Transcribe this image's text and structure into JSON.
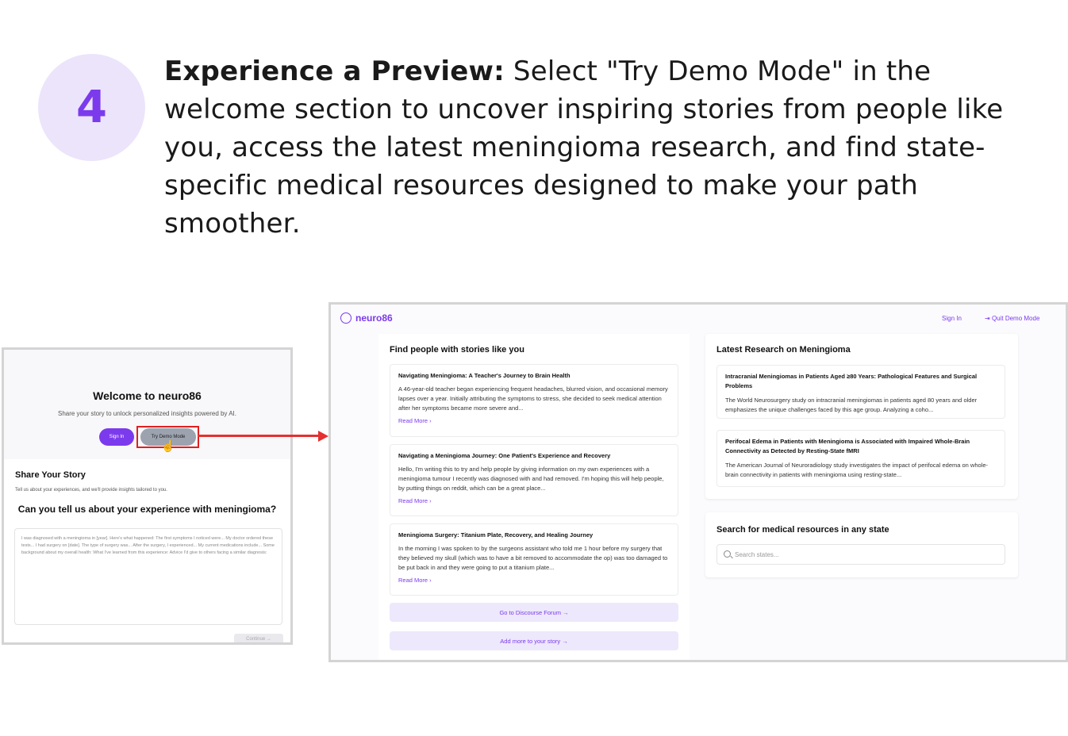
{
  "step": {
    "number": "4",
    "bold_text": "Experience a Preview:",
    "text": " Select \"Try Demo Mode\" in the welcome section to uncover inspiring stories from people like you, access the latest meningioma research, and find state-specific medical resources designed to make your path smoother."
  },
  "left_screen": {
    "welcome_title": "Welcome to neuro86",
    "welcome_sub": "Share your story to unlock personalized insights powered by AI.",
    "sign_in": "Sign In",
    "try_demo": "Try Demo Mode",
    "share_title": "Share Your Story",
    "share_sub": "Tell us about your experiences, and we'll provide insights tailored to you.",
    "question": "Can you tell us about your experience with meningioma?",
    "placeholder": "I was diagnosed with a meningioma in [year]. Here's what happened: The first symptoms I noticed were... My doctor ordered these tests... I had surgery on [date]. The type of surgery was... After the surgery, I experienced... My current medications include... Some background about my overall health: What I've learned from this experience: Advice I'd give to others facing a similar diagnosis:",
    "continue": "Continue →"
  },
  "right_screen": {
    "brand": "neuro86",
    "sign_in": "Sign In",
    "quit_demo": "Quit Demo Mode",
    "stories_title": "Find people with stories like you",
    "stories": [
      {
        "title": "Navigating Meningioma: A Teacher's Journey to Brain Health",
        "body": "A 46-year-old teacher began experiencing frequent headaches, blurred vision, and occasional memory lapses over a year. Initially attributing the symptoms to stress, she decided to seek medical attention after her symptoms became more severe and...",
        "read_more": "Read More  ›"
      },
      {
        "title": "Navigating a Meningioma Journey: One Patient's Experience and Recovery",
        "body": "Hello, I'm writing this to try and help people by giving information on my own experiences with a meningioma tumour I recently was diagnosed with and had removed. I'm hoping this will help people, by putting things on reddit, which can be a great place...",
        "read_more": "Read More  ›"
      },
      {
        "title": "Meningioma Surgery: Titanium Plate, Recovery, and Healing Journey",
        "body": "In the morning I was spoken to by the surgeons assistant who told me 1 hour before my surgery that they believed my skull (which was to have a bit removed to accommodate the op) was too damaged to be put back in and they were going to put a titanium plate...",
        "read_more": "Read More  ›"
      }
    ],
    "forum_btn": "Go to Discourse Forum  →",
    "add_story_btn": "Add more to your story  →",
    "research_title": "Latest Research on Meningioma",
    "research": [
      {
        "title": "Intracranial Meningiomas in Patients Aged ≥80 Years: Pathological Features and Surgical Problems",
        "body": "The World Neurosurgery study on intracranial meningiomas in patients aged 80 years and older emphasizes the unique challenges faced by this age group. Analyzing a coho..."
      },
      {
        "title": "Perifocal Edema in Patients with Meningioma is Associated with Impaired Whole-Brain Connectivity as Detected by Resting-State fMRI",
        "body": "The American Journal of Neuroradiology study investigates the impact of perifocal edema on whole-brain connectivity in patients with meningioma using resting-state..."
      }
    ],
    "resources_title": "Search for medical resources in any state",
    "search_placeholder": "Search states..."
  },
  "colors": {
    "accent": "#7c3aed",
    "highlight": "#e02020"
  }
}
